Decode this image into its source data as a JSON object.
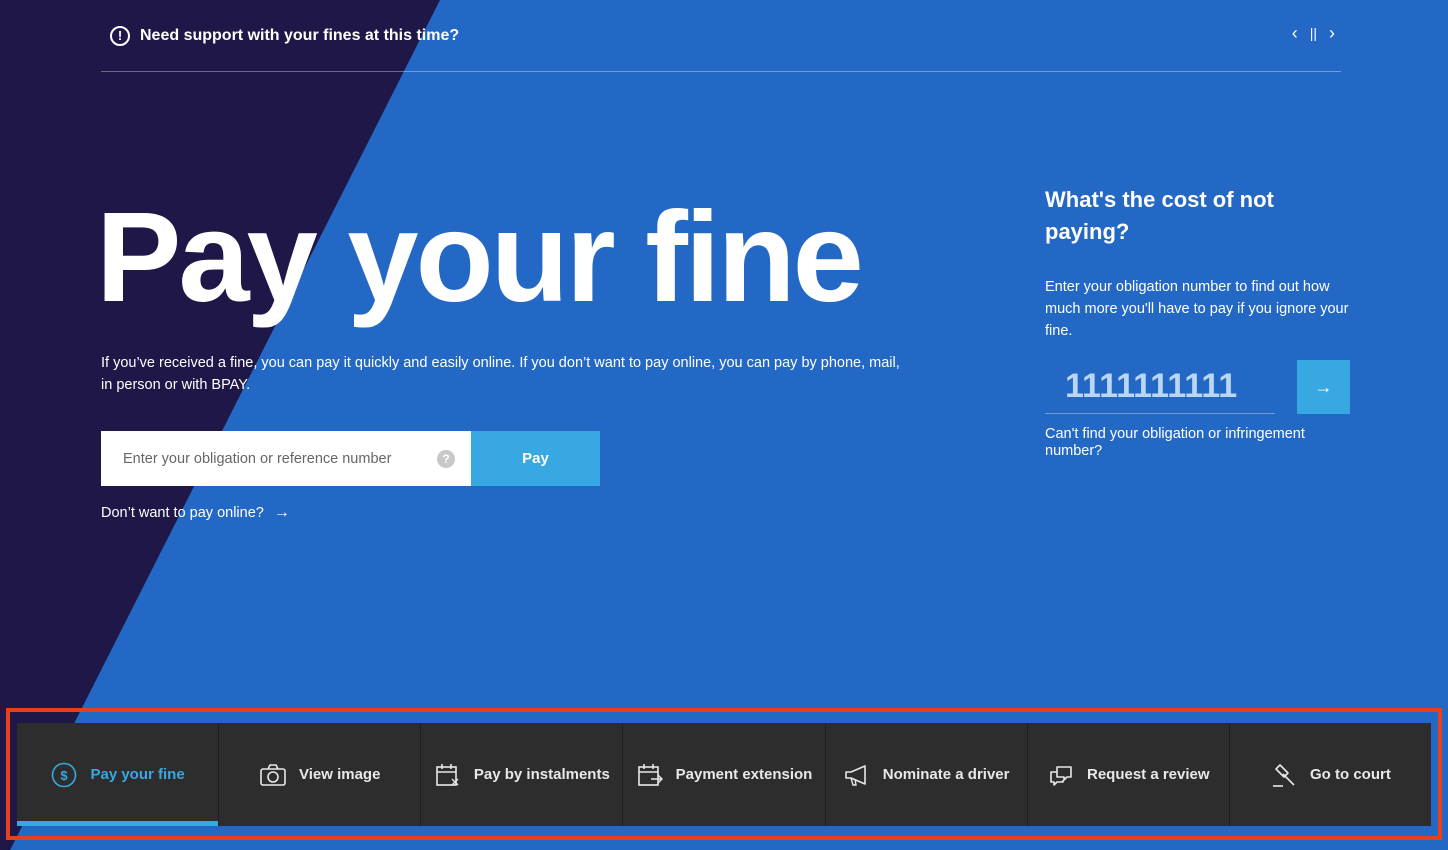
{
  "banner": {
    "icon": "exclamation-icon",
    "text": "Need support with your fines at this time?",
    "prev": "‹",
    "pause": "||",
    "next": "›"
  },
  "hero": {
    "title": "Pay your fine",
    "description": "If you’ve received a fine, you can pay it quickly and easily online. If you don’t want to pay online, you can pay by phone, mail, in person or with BPAY.",
    "search_placeholder": "Enter your obligation or reference number",
    "help_icon": "?",
    "pay_label": "Pay",
    "alt_link": "Don’t want to pay online?",
    "alt_arrow": "→"
  },
  "side": {
    "title": "What's the cost of not paying?",
    "description": "Enter your obligation number to find out how much more you'll have to pay if you ignore your fine.",
    "obligation_value": "1111111111",
    "submit_arrow": "→",
    "link": "Can't find your obligation or infringement number?"
  },
  "nav": {
    "items": [
      {
        "label": "Pay your fine",
        "icon": "dollar-circle-icon",
        "active": true
      },
      {
        "label": "View image",
        "icon": "camera-icon",
        "active": false
      },
      {
        "label": "Pay by instalments",
        "icon": "calendar-icon",
        "active": false
      },
      {
        "label": "Payment extension",
        "icon": "calendar-arrow-icon",
        "active": false
      },
      {
        "label": "Nominate a driver",
        "icon": "megaphone-icon",
        "active": false
      },
      {
        "label": "Request a review",
        "icon": "chat-bubbles-icon",
        "active": false
      },
      {
        "label": "Go to court",
        "icon": "gavel-icon",
        "active": false
      }
    ]
  },
  "colors": {
    "dark_bg": "#1e1747",
    "blue_bg": "#2468c6",
    "accent": "#38a8e2",
    "nav_bg": "#2d2d2d",
    "highlight": "#e8401c"
  }
}
